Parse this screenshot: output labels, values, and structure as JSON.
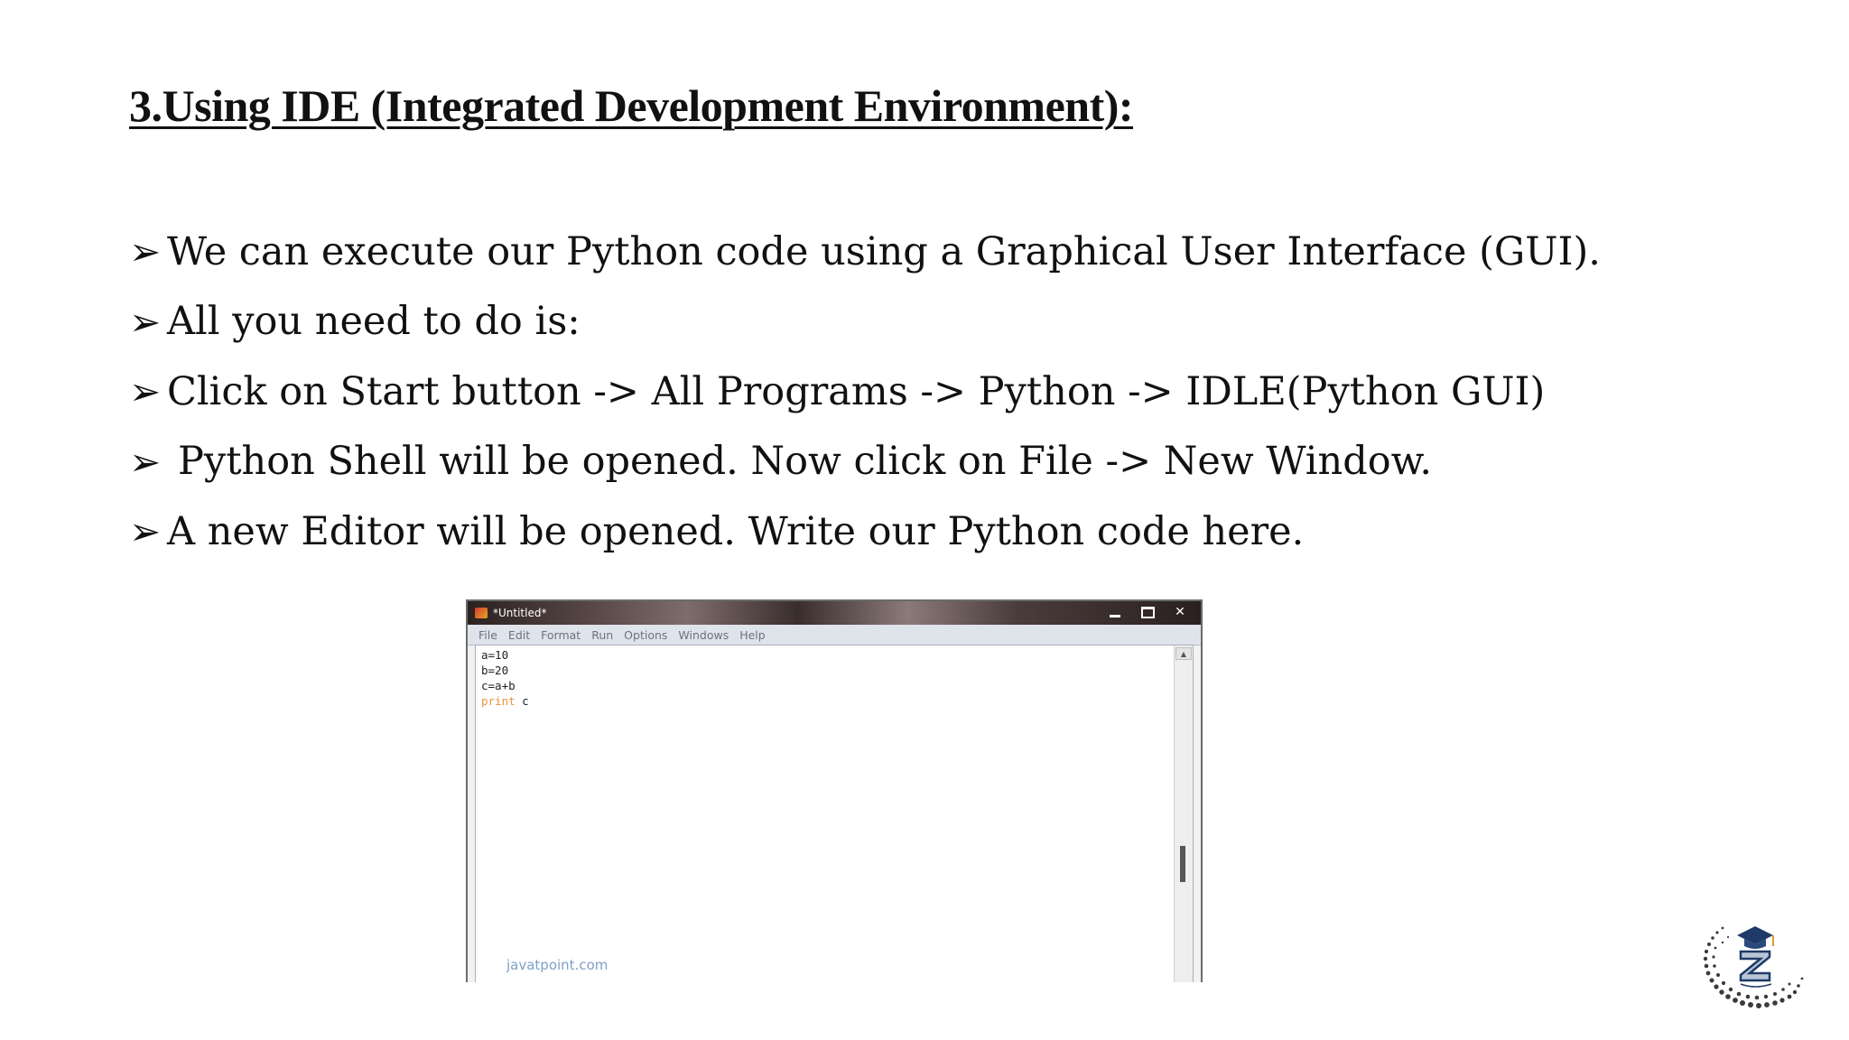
{
  "slide": {
    "title": "3.Using IDE (Integrated Development Environment):",
    "bullets": [
      "We can execute our Python code using a Graphical User Interface (GUI).",
      "All you need to do is:",
      "Click on Start button -> All Programs -> Python -> IDLE(Python GUI)",
      "Python Shell will be opened. Now click on File -> New Window.",
      "A new Editor will be opened. Write our Python code here."
    ],
    "bullet_icon": "arrowhead-bullet-icon"
  },
  "idle_window": {
    "title": "*Untitled*",
    "menu": [
      "File",
      "Edit",
      "Format",
      "Run",
      "Options",
      "Windows",
      "Help"
    ],
    "code_lines": [
      "a=10",
      "b=20",
      "c=a+b"
    ],
    "print_keyword": "print",
    "print_arg": "c",
    "keyword_color": "#e6953a",
    "watermark": "javatpoint.com"
  },
  "logo": {
    "icon": "z-graduation-cap-logo-icon"
  }
}
